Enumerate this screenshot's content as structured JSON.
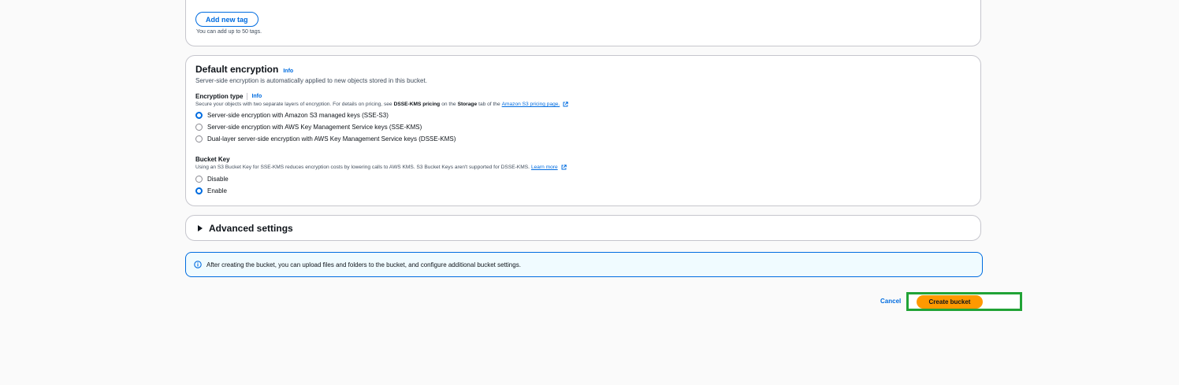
{
  "tags": {
    "add_label": "Add new tag",
    "hint": "You can add up to 50 tags."
  },
  "encryption": {
    "title": "Default encryption",
    "info": "Info",
    "description": "Server-side encryption is automatically applied to new objects stored in this bucket.",
    "type_title": "Encryption type",
    "type_info": "Info",
    "type_desc_pre": "Secure your objects with two separate layers of encryption. For details on pricing, see",
    "type_desc_bold1": "DSSE-KMS pricing",
    "type_desc_mid": "on the",
    "type_desc_bold2": "Storage",
    "type_desc_post": "tab of the",
    "type_desc_link": "Amazon S3 pricing page.",
    "options": [
      {
        "label": "Server-side encryption with Amazon S3 managed keys (SSE-S3)",
        "checked": true
      },
      {
        "label": "Server-side encryption with AWS Key Management Service keys (SSE-KMS)",
        "checked": false
      },
      {
        "label": "Dual-layer server-side encryption with AWS Key Management Service keys (DSSE-KMS)",
        "checked": false
      }
    ],
    "bucket_key_title": "Bucket Key",
    "bucket_key_desc": "Using an S3 Bucket Key for SSE-KMS reduces encryption costs by lowering calls to AWS KMS. S3 Bucket Keys aren't supported for DSSE-KMS.",
    "bucket_key_link": "Learn more",
    "bucket_key_options": [
      {
        "label": "Disable",
        "checked": false
      },
      {
        "label": "Enable",
        "checked": true
      }
    ]
  },
  "advanced": {
    "label": "Advanced settings"
  },
  "alert": {
    "text": "After creating the bucket, you can upload files and folders to the bucket, and configure additional bucket settings."
  },
  "actions": {
    "cancel": "Cancel",
    "create": "Create bucket"
  },
  "colors": {
    "primary": "#006ce0",
    "create_button": "#ff9900",
    "highlight": "#21a336"
  }
}
